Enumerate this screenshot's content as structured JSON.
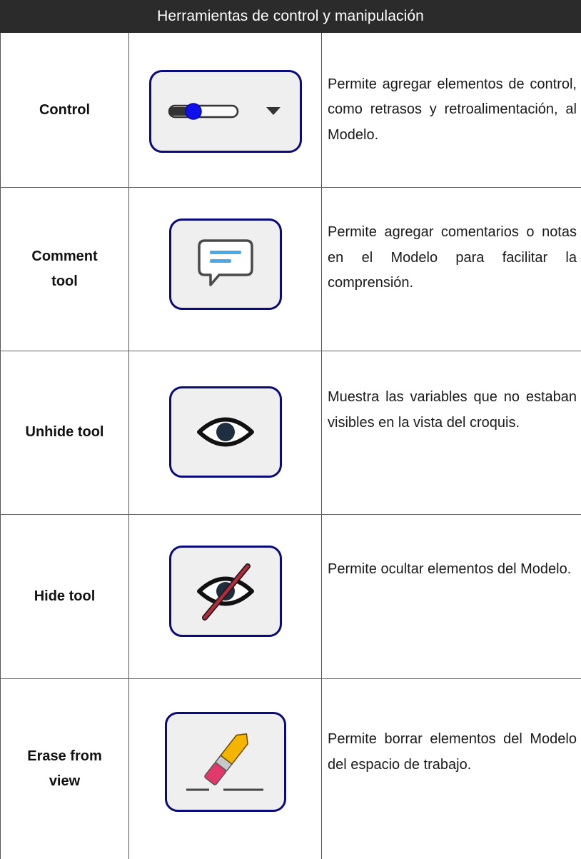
{
  "header": {
    "title": "Herramientas de control y manipulación"
  },
  "rows": [
    {
      "name": "Control",
      "icon": "slider-dropdown-icon",
      "description": "Permite agregar elementos de control, como retrasos y retroalimentación, al Modelo."
    },
    {
      "name": "Comment tool",
      "icon": "comment-bubble-icon",
      "description": "Permite agregar comentarios o notas en el Modelo para facilitar la comprensión."
    },
    {
      "name": "Unhide tool",
      "icon": "eye-icon",
      "description": "Muestra las variables que no estaban visibles en la vista del croquis."
    },
    {
      "name": "Hide tool",
      "icon": "eye-slash-icon",
      "description": "Permite ocultar elementos del Modelo."
    },
    {
      "name": "Erase from view",
      "icon": "eraser-icon",
      "description": "Permite borrar elementos del Modelo del espacio de trabajo."
    }
  ],
  "colors": {
    "header_bg": "#2b2b2b",
    "icon_border": "#0a0a7a",
    "icon_bg": "#efefef"
  }
}
